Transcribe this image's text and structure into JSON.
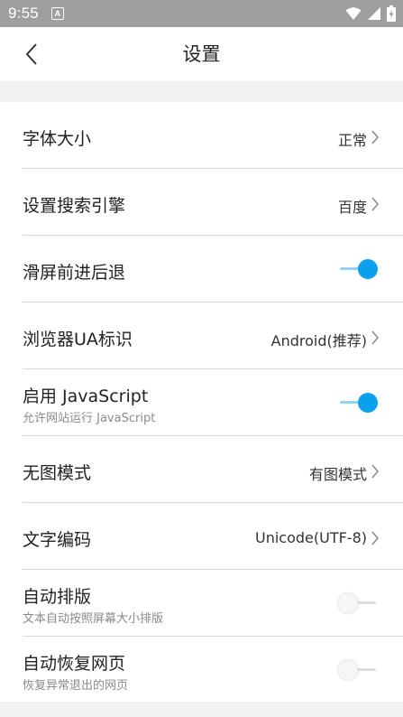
{
  "status_bar": {
    "time": "9:55",
    "notification_badge": "A"
  },
  "header": {
    "title": "设置"
  },
  "settings": [
    {
      "label": "字体大小",
      "value": "正常",
      "type": "link"
    },
    {
      "label": "设置搜索引擎",
      "value": "百度",
      "type": "link"
    },
    {
      "label": "滑屏前进后退",
      "type": "toggle",
      "on": true
    },
    {
      "label": "浏览器UA标识",
      "value": "Android(推荐)",
      "type": "link"
    },
    {
      "label": "启用 JavaScript",
      "sub": "允许网站运行 JavaScript",
      "type": "toggle",
      "on": true
    },
    {
      "label": "无图模式",
      "value": "有图模式",
      "type": "link"
    },
    {
      "label": "文字编码",
      "value": "Unicode(UTF-8)",
      "type": "link"
    },
    {
      "label": "自动排版",
      "sub": "文本自动按照屏幕大小排版",
      "type": "toggle",
      "on": false
    },
    {
      "label": "自动恢复网页",
      "sub": "恢复异常退出的网页",
      "type": "toggle",
      "on": false
    }
  ],
  "colors": {
    "accent": "#0aa0ee",
    "status_bar": "#9e9e9e",
    "page_background": "#f1f1f1"
  }
}
